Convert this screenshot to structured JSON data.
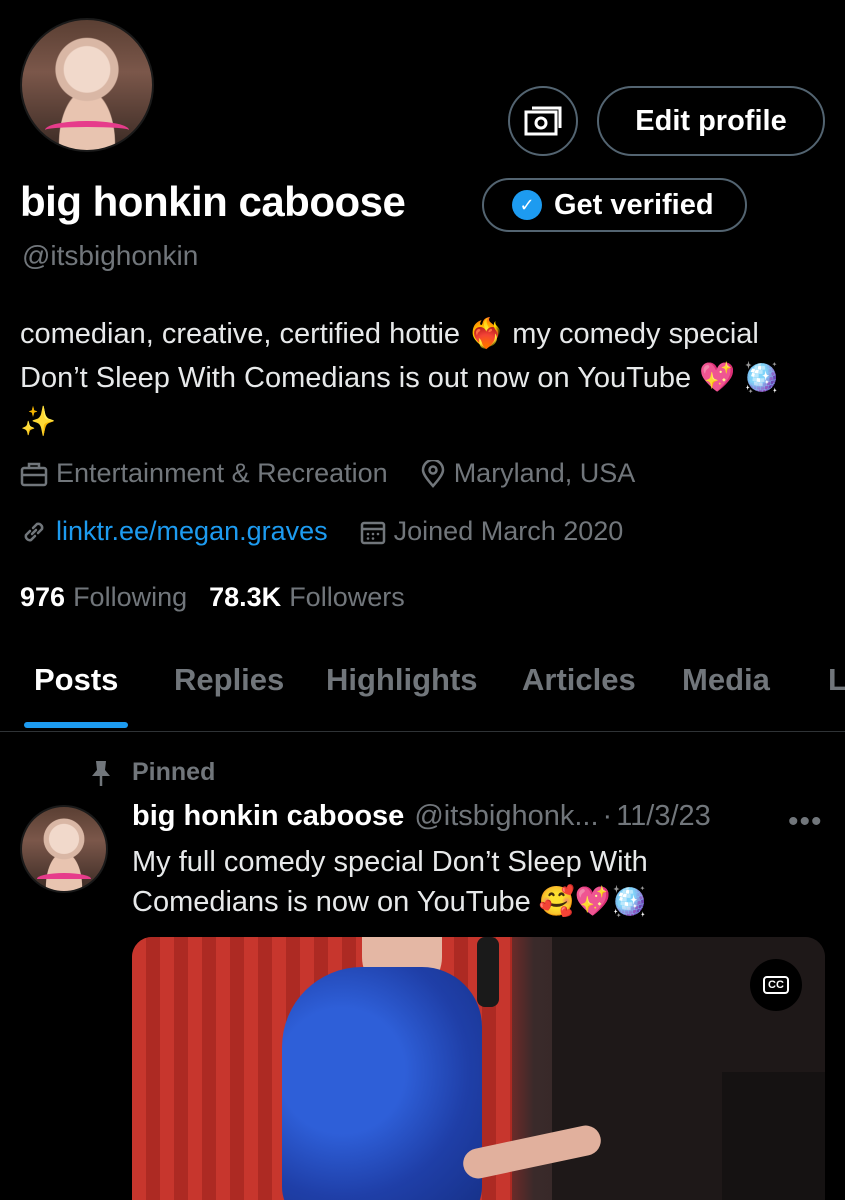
{
  "profile": {
    "display_name": "big honkin caboose",
    "handle": "@itsbighonkin",
    "edit_profile_label": "Edit profile",
    "get_verified_label": "Get verified",
    "bio": "comedian, creative, certified hottie ❤️‍🔥 my comedy special Don’t Sleep With Comedians is out now on YouTube 💖 🪩✨",
    "category": "Entertainment & Recreation",
    "location": "Maryland, USA",
    "link": "linktr.ee/megan.graves",
    "joined": "Joined March 2020",
    "following_count": "976",
    "following_label": "Following",
    "followers_count": "78.3K",
    "followers_label": "Followers"
  },
  "tabs": [
    {
      "label": "Posts",
      "active": true
    },
    {
      "label": "Replies"
    },
    {
      "label": "Highlights"
    },
    {
      "label": "Articles"
    },
    {
      "label": "Media"
    },
    {
      "label": "L"
    }
  ],
  "pinned_post": {
    "pinned_label": "Pinned",
    "author": "big honkin caboose",
    "handle": "@itsbighonk...",
    "separator": "·",
    "date": "11/3/23",
    "more": "•••",
    "text": "My full comedy special Don’t Sleep With Comedians is now on YouTube 🥰💖🪩",
    "cc_label": "CC"
  },
  "colors": {
    "background": "#000000",
    "accent": "#1d9bf0",
    "muted": "#71767b",
    "border": "#536471"
  },
  "icons": [
    "tip-jar-icon",
    "verified-badge-icon",
    "briefcase-icon",
    "location-pin-icon",
    "link-icon",
    "calendar-icon",
    "pin-icon",
    "more-icon",
    "cc-icon"
  ]
}
